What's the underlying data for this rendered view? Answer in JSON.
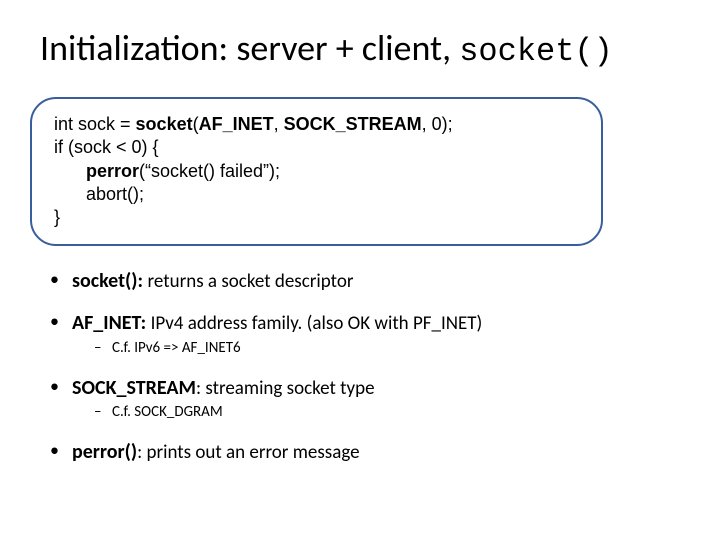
{
  "title_main": "Initialization: server + client, ",
  "title_fn": "socket()",
  "code": {
    "l1a": "int sock = ",
    "l1b": "socket",
    "l1c": "(",
    "l1d": "AF_INET",
    "l1e": ", ",
    "l1f": "SOCK_STREAM",
    "l1g": ", 0);",
    "l2": "if (sock < 0) {",
    "l3a": "perror",
    "l3b": "(“socket() failed”);",
    "l4": "abort();",
    "l5": "}"
  },
  "bullets": [
    {
      "lead": "socket(): ",
      "tail_bold": "returns a socket descriptor",
      "tail_plain": "",
      "sub": []
    },
    {
      "lead": "AF_INET: ",
      "tail_bold": "IPv4 address family. (",
      "tail_plain": "also OK with PF_INET)",
      "sub": [
        "C.f. IPv6 => AF_INET6"
      ]
    },
    {
      "lead": "SOCK_STREAM",
      "tail_bold": ": streaming socket type",
      "tail_plain": "",
      "sub": [
        "C.f. SOCK_DGRAM"
      ]
    },
    {
      "lead": "perror()",
      "tail_bold": "",
      "tail_plain": ": prints out an error message",
      "sub": []
    }
  ]
}
